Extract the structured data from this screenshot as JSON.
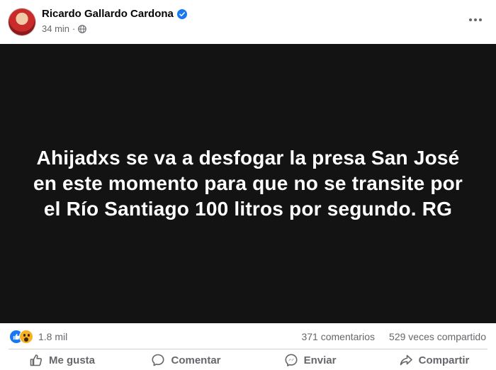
{
  "post": {
    "author": "Ricardo Gallardo Cardona",
    "time": "34 min",
    "dot": "·",
    "image_text_lines": [
      "Ahijadxs se va a desfogar la presa San José",
      "en este momento para que no se transite por",
      "el Río Santiago 100 litros por segundo. RG"
    ]
  },
  "stats": {
    "reactions": "1.8 mil",
    "comments": "371 comentarios",
    "shares": "529 veces compartido"
  },
  "actions": {
    "like": "Me gusta",
    "comment": "Comentar",
    "send": "Enviar",
    "share": "Compartir"
  },
  "icons": {
    "verified": "verified-badge-icon",
    "privacy": "globe-icon",
    "more": "more-options-icon",
    "reaction_like": "like-reaction-icon",
    "reaction_wow": "wow-reaction-icon",
    "like": "thumbs-up-icon",
    "comment": "comment-bubble-icon",
    "send": "messenger-icon",
    "share": "share-arrow-icon"
  },
  "colors": {
    "verified": "#1877f2",
    "image_background": "#131313",
    "secondary_text": "#65676b"
  }
}
